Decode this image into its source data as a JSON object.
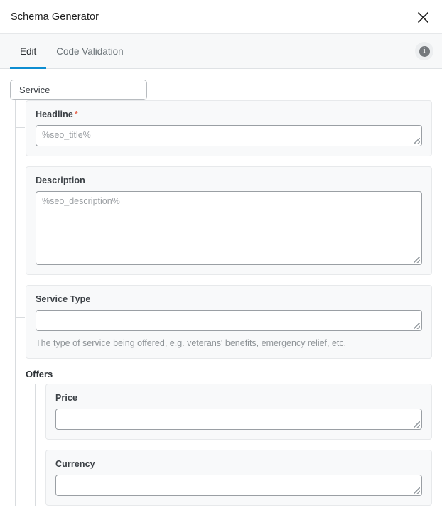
{
  "window": {
    "title": "Schema Generator",
    "close_icon": "close-icon"
  },
  "tabs": {
    "items": [
      {
        "label": "Edit",
        "active": true
      },
      {
        "label": "Code Validation",
        "active": false
      }
    ],
    "info_icon": "info-icon",
    "info_glyph": "i",
    "active_underline_color": "#0d8dd1"
  },
  "schema": {
    "root_type": "Service",
    "fields": [
      {
        "label": "Headline",
        "required": true,
        "required_marker": "*",
        "value": "",
        "placeholder": "%seo_title%",
        "help": ""
      },
      {
        "label": "Description",
        "required": false,
        "required_marker": "",
        "value": "",
        "placeholder": "%seo_description%",
        "help": ""
      },
      {
        "label": "Service Type",
        "required": false,
        "required_marker": "",
        "value": "",
        "placeholder": "",
        "help": "The type of service being offered, e.g. veterans' benefits, emergency relief, etc."
      }
    ],
    "groups": [
      {
        "label": "Offers",
        "fields": [
          {
            "label": "Price",
            "value": "",
            "placeholder": "",
            "help": ""
          },
          {
            "label": "Currency",
            "value": "",
            "placeholder": "",
            "help": ""
          }
        ]
      }
    ]
  }
}
